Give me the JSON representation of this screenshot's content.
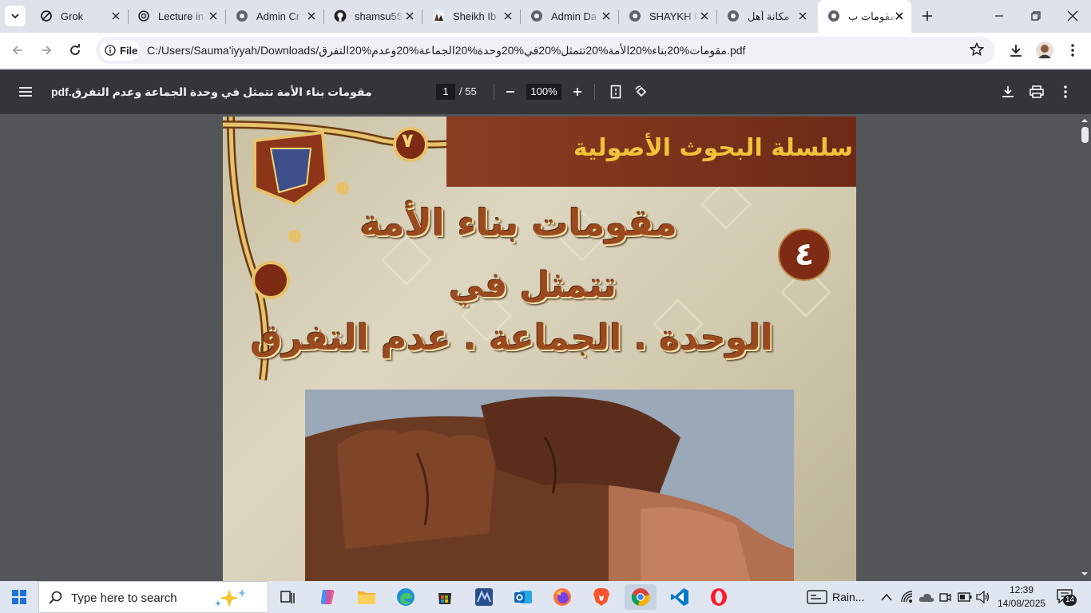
{
  "browser": {
    "tabs": [
      {
        "title": "Grok",
        "icon": "grok-icon",
        "active": false
      },
      {
        "title": "Lecture in",
        "icon": "chatgpt-icon",
        "active": false
      },
      {
        "title": "Admin Cr",
        "icon": "chrome-site-icon",
        "active": false
      },
      {
        "title": "shamsu55",
        "icon": "github-icon",
        "active": false
      },
      {
        "title": "Sheikh Ib",
        "icon": "sheikh-site-icon",
        "active": false
      },
      {
        "title": "Admin Da",
        "icon": "chrome-site-icon",
        "active": false
      },
      {
        "title": "SHAYKH I",
        "icon": "chrome-site-icon",
        "active": false
      },
      {
        "title": "مكانة أهل",
        "icon": "chrome-site-icon",
        "active": false
      },
      {
        "title": "مقومات ب",
        "icon": "chrome-site-icon",
        "active": true
      }
    ],
    "address": {
      "chip_label": "File",
      "url": "C:/Users/Sauma'iyyah/Downloads/مقومات%20بناء%20الأمة%20تتمثل%20في%20وحدة%20الجماعة%20وعدم%20التفرق.pdf"
    }
  },
  "pdf_viewer": {
    "file_title": "مقومات بناء الأمة تتمثل في وحدة الجماعة وعدم التفرق.pdf",
    "current_page": "1",
    "total_pages": "/ 55",
    "zoom": "100%"
  },
  "document_page": {
    "series_title": "سلسلة البحوث الأصولية",
    "title_line1": "مقومات بناء الأمة",
    "title_line2": "تتمثل في",
    "title_line3": "الوحدة . الجماعة . عدم التفرق",
    "badge_number": "٤",
    "corner_number": "٧"
  },
  "taskbar": {
    "search_placeholder": "Type here to search",
    "pinned_icons": [
      "copilot-icon",
      "task-view-icon",
      "copilot-app-icon",
      "file-explorer-icon",
      "edge-icon",
      "store-icon",
      "vpn-icon",
      "outlook-icon",
      "firefox-icon",
      "brave-icon",
      "chrome-icon",
      "vscode-icon",
      "opera-icon"
    ],
    "weather": "Rain...",
    "time": "12:39",
    "date": "14/08/2025",
    "notification_count": "14"
  },
  "colors": {
    "tabbar": "#dee3eb",
    "pdf_toolbar": "#323639",
    "viewer_bg": "#525659",
    "series_band": "#8b3d22",
    "series_text": "#f2c23a"
  }
}
